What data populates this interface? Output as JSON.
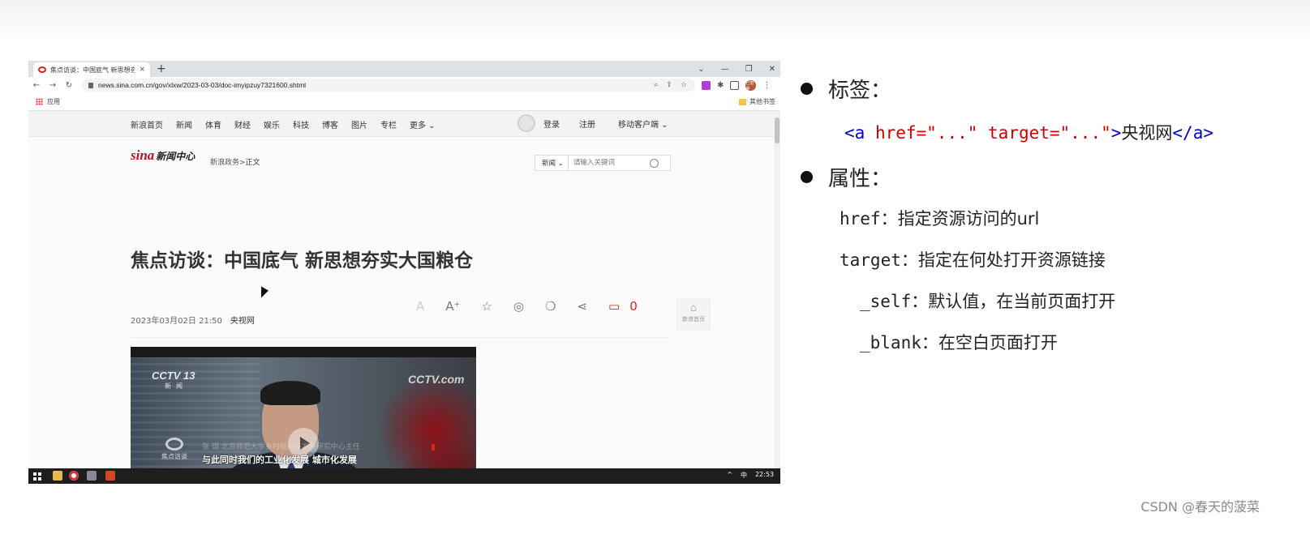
{
  "browser": {
    "tab_title": "焦点访谈：中国底气 新思想夯实大国粮仓",
    "tab_close": "×",
    "new_tab": "+",
    "url": "news.sina.com.cn/gov/xlxw/2023-03-03/doc-imyipzuy7321600.shtml",
    "bookmarks": {
      "apps": "应用",
      "other": "其他书签"
    },
    "avatar_text": "已暂停"
  },
  "sina": {
    "nav_items": [
      "新浪首页",
      "新闻",
      "体育",
      "财经",
      "娱乐",
      "科技",
      "博客",
      "图片",
      "专栏",
      "更多 ⌄"
    ],
    "login": "登录",
    "register": "注册",
    "mobile": "移动客户端 ⌄",
    "logo_sina": "sina",
    "logo_center": "新闻中心",
    "breadcrumb_section": "新浪政务",
    "breadcrumb_sep": ">",
    "breadcrumb_current": "正文",
    "search_category": "新闻 ⌄",
    "search_placeholder": "请输入关键词",
    "headline": "焦点访谈：中国底气 新思想夯实大国粮仓",
    "date": "2023年03月02日 21:50",
    "source": "央视网",
    "comment_count": "0",
    "home_label": "新浪首页",
    "video": {
      "cctv13": "CCTV 13",
      "cctv13_sub": "新闻",
      "cctvcom": "CCTV.com",
      "brand": "焦点访谈",
      "name_band": "张 琪 北京师范大学乡村振兴与发展研究中心主任",
      "subtitle": "与此同时我们的工业化发展 城市化发展"
    }
  },
  "taskbar": {
    "ime": "中",
    "time": "22:53",
    "caret": "^"
  },
  "slide": {
    "bullet1": "标签：",
    "code": {
      "open1": "<a",
      "attr1": " href=\"...\"",
      "attr2": " target=\"...\"",
      "gt": ">",
      "text": "央视网",
      "close": "</a>"
    },
    "bullet2": "属性：",
    "href_key": "href",
    "href_desc": "：指定资源访问的url",
    "target_key": "target",
    "target_desc": "：指定在何处打开资源链接",
    "self_key": "_self",
    "self_desc": "：默认值，在当前页面打开",
    "blank_key": "_blank",
    "blank_desc": "：在空白页面打开"
  },
  "watermark": "CSDN @春天的菠菜"
}
